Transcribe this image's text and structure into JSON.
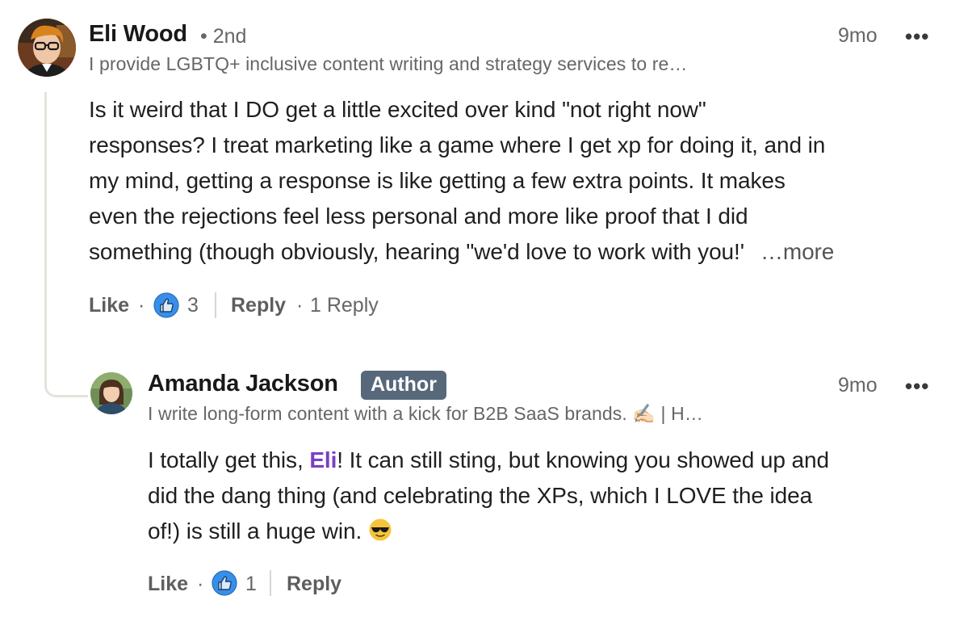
{
  "comment": {
    "author_name": "Eli Wood",
    "degree": "• 2nd",
    "headline": "I provide LGBTQ+ inclusive content writing and strategy services to re…",
    "timestamp": "9mo",
    "menu": "•••",
    "body_lines": [
      "Is it weird that I DO get a little excited over kind \"not right now\"",
      "responses? I treat marketing like a game where I get xp for doing it, and in",
      "my mind, getting a response is like getting a few extra points. It makes",
      "even the rejections feel less personal and more like proof that I did",
      "something (though obviously, hearing \"we'd love to work with you!'"
    ],
    "more_label": "…more",
    "like_label": "Like",
    "dot": "·",
    "reaction_count": "3",
    "reply_label": "Reply",
    "replies_count_label": "1 Reply"
  },
  "reply": {
    "author_name": "Amanda Jackson",
    "badge": "Author",
    "headline": "I write long-form content with a kick for B2B SaaS brands. ✍🏻 | H…",
    "timestamp": "9mo",
    "menu": "•••",
    "line1_before": "I totally get this, ",
    "mention": "Eli",
    "line1_after": "! It can still sting, but knowing you showed up and",
    "line2": "did the dang thing (and celebrating the XPs, which I LOVE the idea",
    "line3": "of!) is still a huge win.",
    "emoji": "😎",
    "like_label": "Like",
    "dot": "·",
    "reaction_count": "1",
    "reply_label": "Reply"
  },
  "colors": {
    "like_blue": "#378fe9",
    "mention_purple": "#7a3fc4",
    "badge_bg": "#56687a",
    "thread_line": "#e6e3dc"
  },
  "icons": {
    "reaction": "thumbs-up-icon",
    "menu": "more-options-icon"
  }
}
